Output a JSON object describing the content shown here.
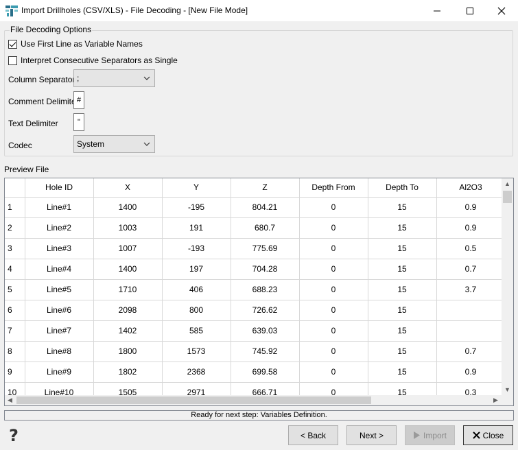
{
  "window": {
    "title": "Import Drillholes (CSV/XLS) - File Decoding - [New File Mode]"
  },
  "options": {
    "legend": "File Decoding Options",
    "use_first_line_label": "Use First Line as Variable Names",
    "use_first_line_checked": true,
    "consecutive_label": "Interpret Consecutive Separators as Single",
    "consecutive_checked": false,
    "column_separator_label": "Column Separator",
    "column_separator_value": ";",
    "comment_delimiter_label": "Comment Delimiter",
    "comment_delimiter_value": "#",
    "text_delimiter_label": "Text Delimiter",
    "text_delimiter_value": "\"",
    "codec_label": "Codec",
    "codec_value": "System"
  },
  "preview": {
    "label": "Preview File",
    "columns": [
      "Hole ID",
      "X",
      "Y",
      "Z",
      "Depth From",
      "Depth To",
      "Al2O3"
    ],
    "rows": [
      {
        "n": "1",
        "cells": [
          "Line#1",
          "1400",
          "-195",
          "804.21",
          "0",
          "15",
          "0.9"
        ]
      },
      {
        "n": "2",
        "cells": [
          "Line#2",
          "1003",
          "191",
          "680.7",
          "0",
          "15",
          "0.9"
        ]
      },
      {
        "n": "3",
        "cells": [
          "Line#3",
          "1007",
          "-193",
          "775.69",
          "0",
          "15",
          "0.5"
        ]
      },
      {
        "n": "4",
        "cells": [
          "Line#4",
          "1400",
          "197",
          "704.28",
          "0",
          "15",
          "0.7"
        ]
      },
      {
        "n": "5",
        "cells": [
          "Line#5",
          "1710",
          "406",
          "688.23",
          "0",
          "15",
          "3.7"
        ]
      },
      {
        "n": "6",
        "cells": [
          "Line#6",
          "2098",
          "800",
          "726.62",
          "0",
          "15",
          ""
        ]
      },
      {
        "n": "7",
        "cells": [
          "Line#7",
          "1402",
          "585",
          "639.03",
          "0",
          "15",
          ""
        ]
      },
      {
        "n": "8",
        "cells": [
          "Line#8",
          "1800",
          "1573",
          "745.92",
          "0",
          "15",
          "0.7"
        ]
      },
      {
        "n": "9",
        "cells": [
          "Line#9",
          "1802",
          "2368",
          "699.58",
          "0",
          "15",
          "0.9"
        ]
      },
      {
        "n": "10",
        "cells": [
          "Line#10",
          "1505",
          "2971",
          "666.71",
          "0",
          "15",
          "0.3"
        ]
      }
    ]
  },
  "status": {
    "text": "Ready for next step: Variables Definition."
  },
  "buttons": {
    "back": "< Back",
    "next": "Next >",
    "import": "Import",
    "close": "Close"
  }
}
